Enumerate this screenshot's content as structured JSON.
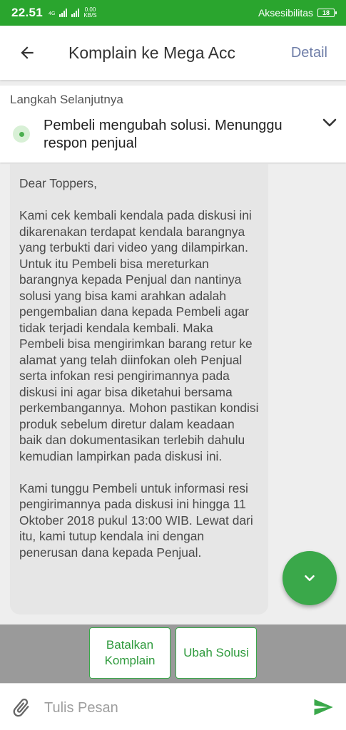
{
  "statusbar": {
    "time": "22.51",
    "net_type": "4G",
    "speed_value": "0.00",
    "speed_unit": "KB/S",
    "accessibility": "Aksesibilitas",
    "battery": "18"
  },
  "header": {
    "title": "Komplain ke Mega Acc",
    "detail_label": "Detail"
  },
  "next_step": {
    "label": "Langkah Selanjutnya",
    "text": "Pembeli mengubah solusi. Menunggu respon penjual"
  },
  "message": {
    "greeting": "Dear Toppers,",
    "paragraph1": "Kami cek kembali kendala pada diskusi ini dikarenakan terdapat kendala barangnya yang terbukti dari video yang dilampirkan. Untuk itu Pembeli bisa mereturkan barangnya kepada Penjual dan nantinya solusi yang bisa kami arahkan adalah pengembalian dana kepada Pembeli agar tidak terjadi kendala kembali. Maka Pembeli bisa mengirimkan barang retur ke alamat yang telah diinfokan oleh Penjual serta infokan resi pengirimannya pada diskusi ini agar bisa diketahui bersama perkembangannya. Mohon pastikan kondisi produk sebelum diretur dalam keadaan baik dan dokumentasikan terlebih dahulu kemudian lampirkan pada diskusi ini.",
    "paragraph2": "Kami tunggu Pembeli untuk informasi resi pengirimannya pada diskusi ini hingga 11 Oktober 2018 pukul 13:00 WIB. Lewat dari itu, kami tutup kendala ini dengan penerusan dana kepada Penjual."
  },
  "actions": {
    "cancel_label": "Batalkan Komplain",
    "change_label": "Ubah Solusi"
  },
  "composer": {
    "placeholder": "Tulis Pesan"
  },
  "colors": {
    "brand_green": "#2aa52e",
    "accent_green": "#3aa84a",
    "detail_link": "#6f7ea8"
  }
}
